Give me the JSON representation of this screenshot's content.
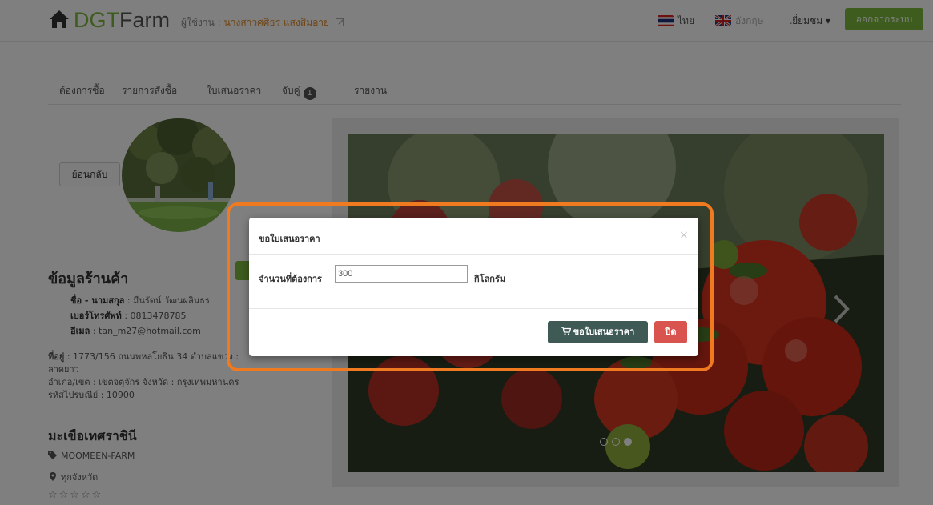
{
  "header": {
    "brand_part1": "DGT",
    "brand_part2": "Farm",
    "user_label": "ผู้ใช้งาน :",
    "user_name": "นางสาวศศิธร แสงสิมอาย",
    "lang_th": "ไทย",
    "lang_en": "อังกฤษ",
    "visitor": "เยี่ยมชม ▾",
    "logout": "ออกจากระบบ"
  },
  "tabs": [
    {
      "label": "ต้องการซื้อ"
    },
    {
      "label": "รายการสั่งซื้อ"
    },
    {
      "label": "ใบเสนอราคา"
    },
    {
      "label": "จับคู่",
      "badge": "1"
    },
    {
      "label": "รายงาน"
    }
  ],
  "left": {
    "back_button": "ย้อนกลับ",
    "shop_title": "ข้อมูลร้านค้า",
    "name_label": "ชื่อ - นามสกุล",
    "name_value": ": มีนรัตน์ วัฒนผลินธร",
    "phone_label": "เบอร์โทรศัพท์",
    "phone_value": ": 0813478785",
    "email_label": "อีเมล",
    "email_value": ": tan_m27@hotmail.com",
    "address_label": "ที่อยู่",
    "address_line1": ": 1773/156 ถนนพหลโยธิน 34 ตำบลแขวง :",
    "address_line2": "ลาดยาว",
    "address_line3": "อำเภอ/เขต : เขตจตุจักร จังหวัด : กรุงเทพมหานคร",
    "address_line4": "รหัสไปรษณีย์ : 10900",
    "product_title": "มะเขือเทศราชินี",
    "farm_tag": "MOOMEEN-FARM",
    "location": "ทุกจังหวัด",
    "stars": "☆☆☆☆☆"
  },
  "modal": {
    "title": "ขอใบเสนอราคา",
    "close_x": "×",
    "quantity_label": "จำนวนที่ต้องการ",
    "quantity_value": "300",
    "unit": "กิโลกรัม",
    "request_button": "ขอใบเสนอราคา",
    "close_button": "ปิด"
  },
  "carousel": {
    "slide_count": 3,
    "active_index": 2
  },
  "colors": {
    "brand_green": "#7ab93b",
    "highlight": "#f07a1f",
    "danger": "#d9534f",
    "primary_dark": "#3f5a55"
  }
}
